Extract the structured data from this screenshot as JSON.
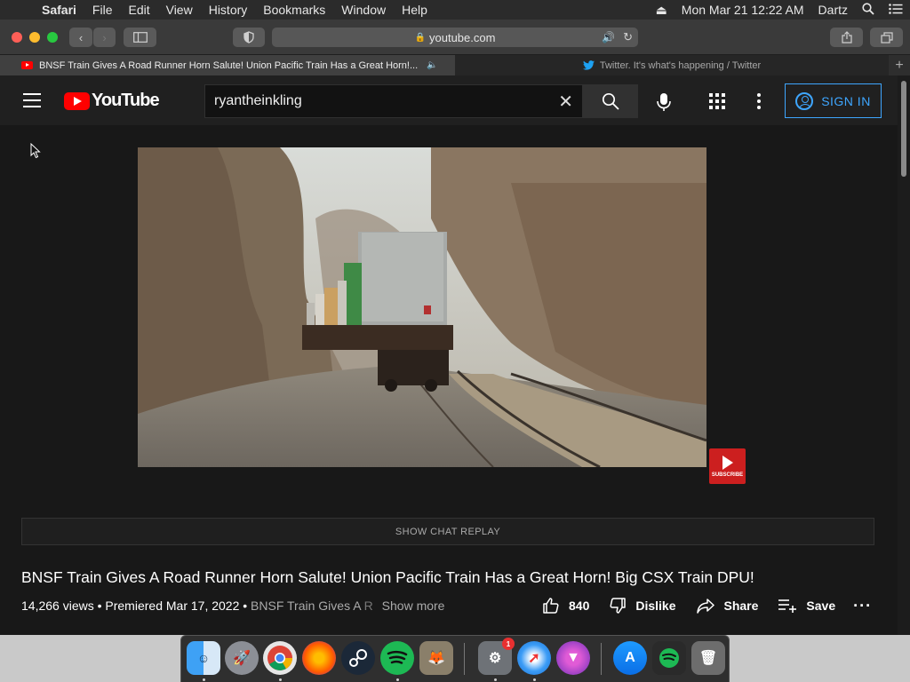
{
  "menubar": {
    "app": "Safari",
    "items": [
      "File",
      "Edit",
      "View",
      "History",
      "Bookmarks",
      "Window",
      "Help"
    ],
    "datetime": "Mon Mar 21  12:22 AM",
    "user": "Dartz"
  },
  "browser": {
    "address": "youtube.com",
    "tabs": [
      {
        "title": "BNSF Train Gives A Road Runner Horn Salute! Union Pacific Train Has a Great Horn!..."
      },
      {
        "title": "Twitter. It's what's happening / Twitter"
      }
    ]
  },
  "youtube": {
    "logo_text": "YouTube",
    "search_value": "ryantheinkling",
    "sign_in": "SIGN IN",
    "subscribe_watermark": "SUBSCRIBE",
    "chat_replay": "SHOW CHAT REPLAY",
    "video_title": "BNSF Train Gives A Road Runner Horn Salute! Union Pacific Train Has a Great Horn! Big CSX Train DPU!",
    "meta_stats": "14,266 views • Premiered Mar 17, 2022 • ",
    "meta_desc": "BNSF Train Gives A",
    "meta_desc_fade": " R",
    "show_more": "Show more",
    "likes": "840",
    "dislike": "Dislike",
    "share": "Share",
    "save": "Save"
  },
  "dock": {
    "badge_count": "1",
    "apps": [
      "finder",
      "launchpad",
      "chrome",
      "firefox",
      "steam",
      "spotify",
      "gimp",
      "system-preferences",
      "safari",
      "firefox-developer",
      "app-store",
      "spotify-alt",
      "trash"
    ]
  }
}
